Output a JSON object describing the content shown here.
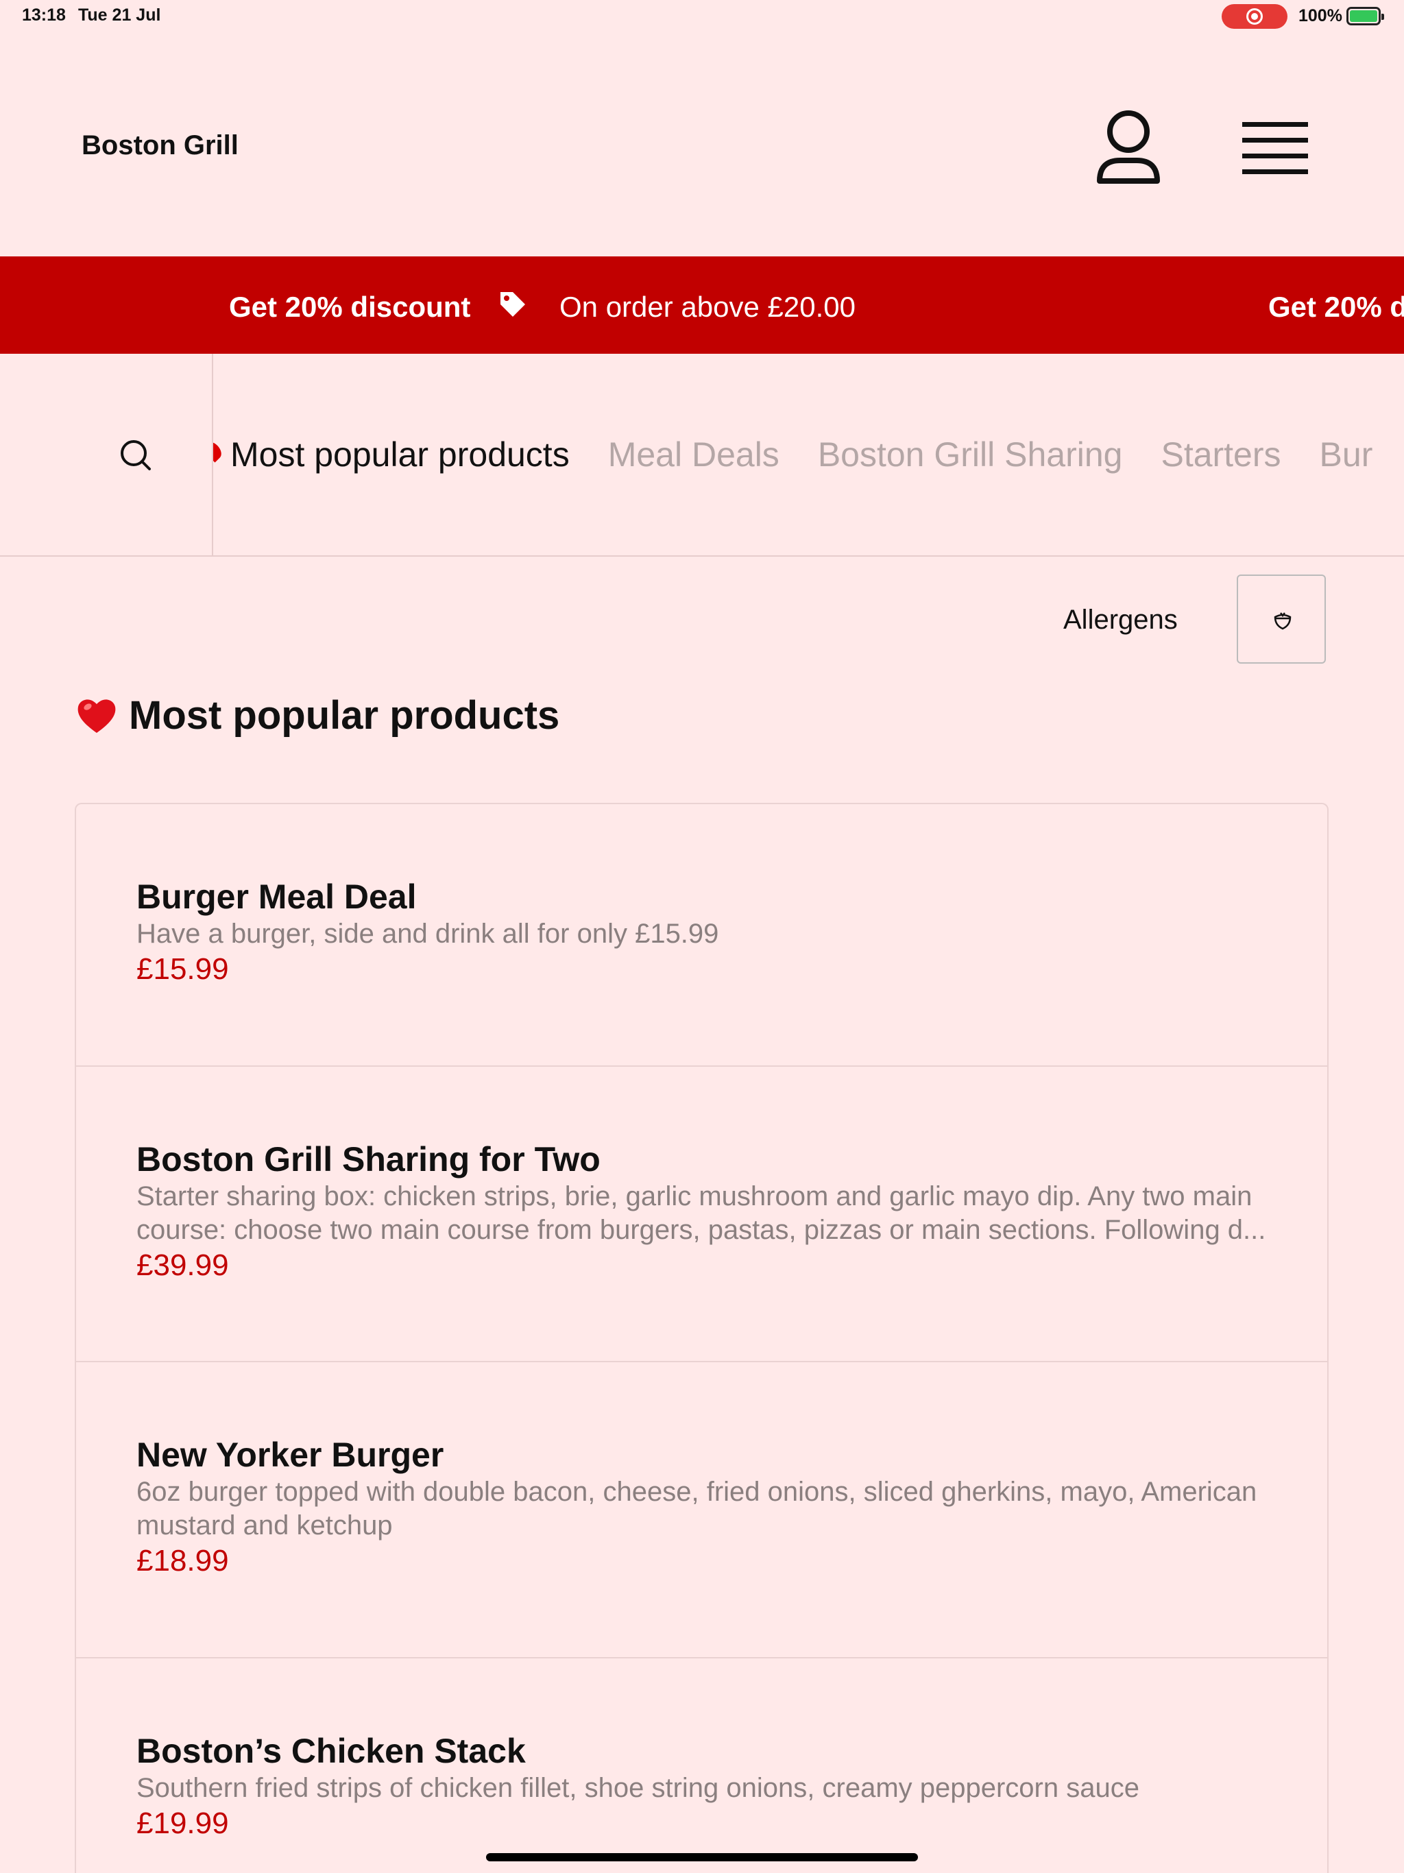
{
  "status_bar": {
    "time": "13:18",
    "date": "Tue 21 Jul",
    "battery": "100%"
  },
  "header": {
    "brand": "Boston Grill"
  },
  "promo": {
    "title": "Get 20% discount",
    "subtitle": "On order above £20.00",
    "title_repeat": "Get 20% d"
  },
  "categories": [
    {
      "label": "Most popular products",
      "active": true
    },
    {
      "label": "Meal Deals",
      "active": false
    },
    {
      "label": "Boston Grill Sharing",
      "active": false
    },
    {
      "label": "Starters",
      "active": false
    },
    {
      "label": "Bur",
      "active": false
    }
  ],
  "allergens": {
    "label": "Allergens"
  },
  "section": {
    "title": "Most popular products"
  },
  "products": [
    {
      "name": "Burger Meal Deal",
      "description": "Have a burger, side and drink all for only £15.99",
      "price": "£15.99"
    },
    {
      "name": "Boston Grill Sharing for Two",
      "description": "Starter sharing box: chicken strips, brie, garlic mushroom and garlic mayo dip.  Any two main course: choose two main course from burgers, pastas, pizzas or main sections. Following d...",
      "price": "£39.99"
    },
    {
      "name": "New Yorker Burger",
      "description": "6oz burger topped with double bacon, cheese, fried onions, sliced gherkins, mayo, American mustard and ketchup",
      "price": "£18.99"
    },
    {
      "name": "Boston’s Chicken Stack",
      "description": "Southern fried strips of chicken fillet, shoe string onions, creamy peppercorn sauce",
      "price": "£19.99"
    }
  ],
  "colors": {
    "background": "#ffe9e9",
    "brand_red": "#c10000",
    "muted_text": "#8a7f7f",
    "inactive_tab": "#b4a6a6"
  },
  "icons": {
    "user": "user-icon",
    "menu": "hamburger-menu-icon",
    "search": "search-icon",
    "tag": "price-tag-icon",
    "filter": "allergen-filter-icon",
    "heart": "heart-icon"
  }
}
